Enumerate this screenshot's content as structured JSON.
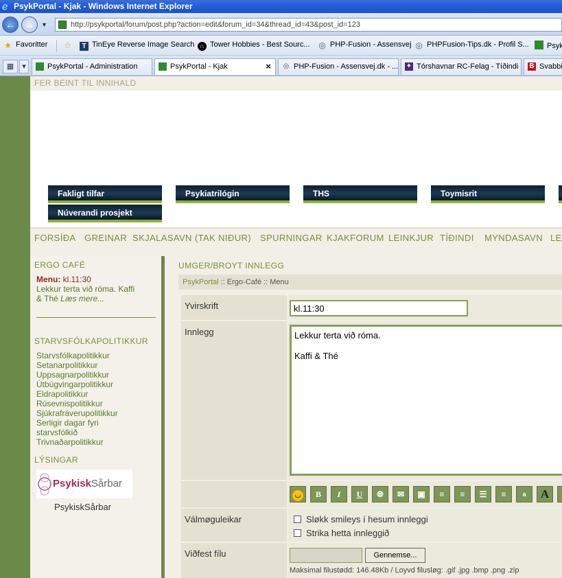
{
  "window": {
    "title": "PsykPortal - Kjak - Windows Internet Explorer"
  },
  "address": {
    "url": "http://psykportal/forum/post.php?action=edit&forum_id=34&thread_id=43&post_id=123"
  },
  "favorites": {
    "label": "Favoritter",
    "items": [
      "TinEye Reverse Image Search",
      "Tower Hobbies - Best Sourc...",
      "PHP-Fusion - Assensvej",
      "PHPFusion-Tips.dk - Profil S...",
      "Psyk"
    ]
  },
  "tabs": [
    {
      "label": "PsykPortal - Administration",
      "active": false
    },
    {
      "label": "PsykPortal - Kjak",
      "active": true
    },
    {
      "label": "PHP-Fusion - Assensvej.dk - ...",
      "active": false
    },
    {
      "label": "Tórshavnar RC-Felag - Tíðindi",
      "active": false
    },
    {
      "label": "Svabbi",
      "active": false
    }
  ],
  "page": {
    "skip_link": "FER BEINT TIL INNIHALD",
    "category_buttons": [
      "Fakligt tilfar",
      "Psykiatrilógin",
      "THS",
      "Toymisrit",
      "Núverandi prosjekt"
    ],
    "menu": [
      "FORSÍÐA",
      "GREINAR",
      "SKJALASAVN (TAK NIÐUR)",
      "SPURNINGAR",
      "KJAKFORUM",
      "LEINKJUR",
      "TÍÐINDI",
      "MYNDASAVN",
      "LE"
    ]
  },
  "sidebar": {
    "ergo_title": "ERGO CAFÉ",
    "menu_prefix": "Menu:",
    "menu_time": "kl.11:30",
    "menu_text_1": "Lekkur terta við róma. Kaffi",
    "menu_text_2": "& Thé",
    "read_more": "Læs mere...",
    "policy_title": "STARVSFÓLKAPOLITIKKUR",
    "policy_links": [
      "Starvsfólkapolitikkur",
      "Setanarpolitikkur",
      "Uppsagnarpolitikkur",
      "Útbúgvingarpolitikkur",
      "Eldrapolitikkur",
      "Rúsevnispolitikkur",
      "Sjúkrafráverupolitikkur",
      "Serligir dagar fyri",
      "starvsfólkið",
      "Trivnaðarpolitikkur"
    ],
    "ads_title": "LÝSINGAR",
    "logo_text_1": "Psykisk",
    "logo_text_2": "Sårbar",
    "logo_caption": "PsykiskSårbar"
  },
  "main": {
    "title": "UMGER/BROYT INNLEGG",
    "breadcrumb_root": "PsykPortal",
    "breadcrumb_rest": ":: Ergo-Café :: Menu",
    "subject_label": "Yvirskrift",
    "subject_value": "kl.11:30",
    "body_label": "Innlegg",
    "body_value": "Lekkur terta við róma.\n\nKaffi & Thé",
    "options_label": "Válmøguleikar",
    "option_1": "Sløkk smileys í hesum innleggi",
    "option_2": "Strika hetta innleggið",
    "attach_label": "Viðfest fílu",
    "browse_button": "Gennemse...",
    "file_note": "Maksimal filustødd: 146.48Kb / Loyvd filusløg: .gif .jpg .bmp .png .zip"
  },
  "toolbar": {
    "buttons": [
      "smiley-icon",
      "B",
      "I",
      "U",
      "link-icon",
      "mail-icon",
      "image-icon",
      "align-left-icon",
      "align-center-icon",
      "align-justify-icon",
      "align-right-icon",
      "a",
      "A"
    ]
  }
}
